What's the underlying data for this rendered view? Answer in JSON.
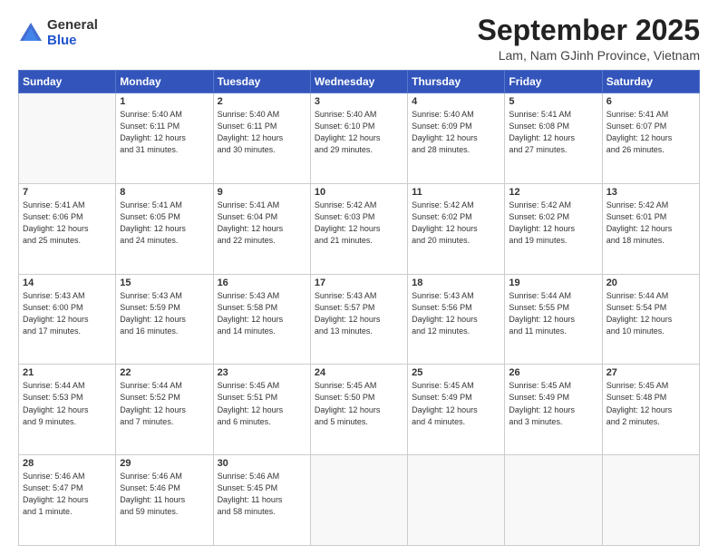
{
  "logo": {
    "general": "General",
    "blue": "Blue"
  },
  "header": {
    "month": "September 2025",
    "location": "Lam, Nam GJinh Province, Vietnam"
  },
  "days": [
    "Sunday",
    "Monday",
    "Tuesday",
    "Wednesday",
    "Thursday",
    "Friday",
    "Saturday"
  ],
  "weeks": [
    [
      {
        "num": "",
        "text": ""
      },
      {
        "num": "1",
        "text": "Sunrise: 5:40 AM\nSunset: 6:11 PM\nDaylight: 12 hours\nand 31 minutes."
      },
      {
        "num": "2",
        "text": "Sunrise: 5:40 AM\nSunset: 6:11 PM\nDaylight: 12 hours\nand 30 minutes."
      },
      {
        "num": "3",
        "text": "Sunrise: 5:40 AM\nSunset: 6:10 PM\nDaylight: 12 hours\nand 29 minutes."
      },
      {
        "num": "4",
        "text": "Sunrise: 5:40 AM\nSunset: 6:09 PM\nDaylight: 12 hours\nand 28 minutes."
      },
      {
        "num": "5",
        "text": "Sunrise: 5:41 AM\nSunset: 6:08 PM\nDaylight: 12 hours\nand 27 minutes."
      },
      {
        "num": "6",
        "text": "Sunrise: 5:41 AM\nSunset: 6:07 PM\nDaylight: 12 hours\nand 26 minutes."
      }
    ],
    [
      {
        "num": "7",
        "text": "Sunrise: 5:41 AM\nSunset: 6:06 PM\nDaylight: 12 hours\nand 25 minutes."
      },
      {
        "num": "8",
        "text": "Sunrise: 5:41 AM\nSunset: 6:05 PM\nDaylight: 12 hours\nand 24 minutes."
      },
      {
        "num": "9",
        "text": "Sunrise: 5:41 AM\nSunset: 6:04 PM\nDaylight: 12 hours\nand 22 minutes."
      },
      {
        "num": "10",
        "text": "Sunrise: 5:42 AM\nSunset: 6:03 PM\nDaylight: 12 hours\nand 21 minutes."
      },
      {
        "num": "11",
        "text": "Sunrise: 5:42 AM\nSunset: 6:02 PM\nDaylight: 12 hours\nand 20 minutes."
      },
      {
        "num": "12",
        "text": "Sunrise: 5:42 AM\nSunset: 6:02 PM\nDaylight: 12 hours\nand 19 minutes."
      },
      {
        "num": "13",
        "text": "Sunrise: 5:42 AM\nSunset: 6:01 PM\nDaylight: 12 hours\nand 18 minutes."
      }
    ],
    [
      {
        "num": "14",
        "text": "Sunrise: 5:43 AM\nSunset: 6:00 PM\nDaylight: 12 hours\nand 17 minutes."
      },
      {
        "num": "15",
        "text": "Sunrise: 5:43 AM\nSunset: 5:59 PM\nDaylight: 12 hours\nand 16 minutes."
      },
      {
        "num": "16",
        "text": "Sunrise: 5:43 AM\nSunset: 5:58 PM\nDaylight: 12 hours\nand 14 minutes."
      },
      {
        "num": "17",
        "text": "Sunrise: 5:43 AM\nSunset: 5:57 PM\nDaylight: 12 hours\nand 13 minutes."
      },
      {
        "num": "18",
        "text": "Sunrise: 5:43 AM\nSunset: 5:56 PM\nDaylight: 12 hours\nand 12 minutes."
      },
      {
        "num": "19",
        "text": "Sunrise: 5:44 AM\nSunset: 5:55 PM\nDaylight: 12 hours\nand 11 minutes."
      },
      {
        "num": "20",
        "text": "Sunrise: 5:44 AM\nSunset: 5:54 PM\nDaylight: 12 hours\nand 10 minutes."
      }
    ],
    [
      {
        "num": "21",
        "text": "Sunrise: 5:44 AM\nSunset: 5:53 PM\nDaylight: 12 hours\nand 9 minutes."
      },
      {
        "num": "22",
        "text": "Sunrise: 5:44 AM\nSunset: 5:52 PM\nDaylight: 12 hours\nand 7 minutes."
      },
      {
        "num": "23",
        "text": "Sunrise: 5:45 AM\nSunset: 5:51 PM\nDaylight: 12 hours\nand 6 minutes."
      },
      {
        "num": "24",
        "text": "Sunrise: 5:45 AM\nSunset: 5:50 PM\nDaylight: 12 hours\nand 5 minutes."
      },
      {
        "num": "25",
        "text": "Sunrise: 5:45 AM\nSunset: 5:49 PM\nDaylight: 12 hours\nand 4 minutes."
      },
      {
        "num": "26",
        "text": "Sunrise: 5:45 AM\nSunset: 5:49 PM\nDaylight: 12 hours\nand 3 minutes."
      },
      {
        "num": "27",
        "text": "Sunrise: 5:45 AM\nSunset: 5:48 PM\nDaylight: 12 hours\nand 2 minutes."
      }
    ],
    [
      {
        "num": "28",
        "text": "Sunrise: 5:46 AM\nSunset: 5:47 PM\nDaylight: 12 hours\nand 1 minute."
      },
      {
        "num": "29",
        "text": "Sunrise: 5:46 AM\nSunset: 5:46 PM\nDaylight: 11 hours\nand 59 minutes."
      },
      {
        "num": "30",
        "text": "Sunrise: 5:46 AM\nSunset: 5:45 PM\nDaylight: 11 hours\nand 58 minutes."
      },
      {
        "num": "",
        "text": ""
      },
      {
        "num": "",
        "text": ""
      },
      {
        "num": "",
        "text": ""
      },
      {
        "num": "",
        "text": ""
      }
    ]
  ]
}
